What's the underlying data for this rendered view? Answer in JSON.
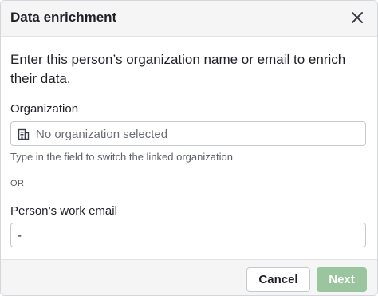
{
  "dialog": {
    "title": "Data enrichment",
    "intro": "Enter this person’s organization name or email to enrich their data."
  },
  "organization": {
    "label": "Organization",
    "placeholder": "No organization selected",
    "hint": "Type in the field to switch the linked organization",
    "icon": "building-icon"
  },
  "divider": {
    "label": "OR"
  },
  "email": {
    "label": "Person’s work email",
    "value": "-"
  },
  "footer": {
    "cancel_label": "Cancel",
    "next_label": "Next"
  },
  "colors": {
    "next_disabled": "#9bc59f",
    "header_bg": "#f5f5f6"
  }
}
